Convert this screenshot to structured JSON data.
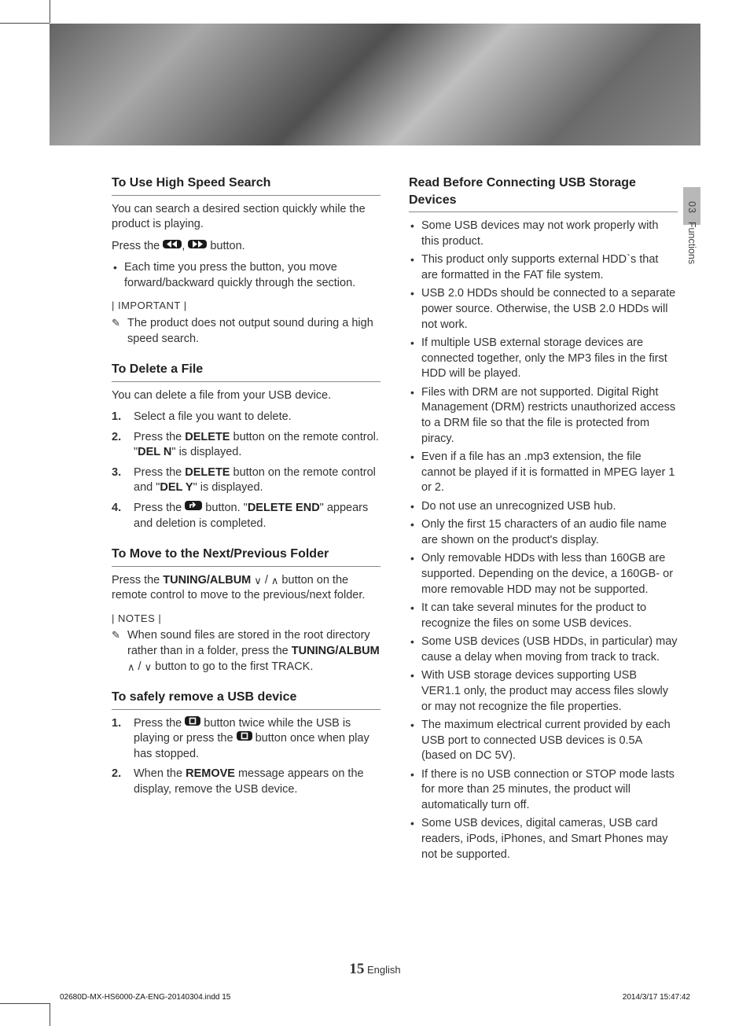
{
  "side": {
    "chapter": "03",
    "label": "Functions"
  },
  "left": {
    "s1": {
      "title": "To Use High Speed Search",
      "intro": "You can search a desired section quickly while the product is playing.",
      "press_pre": "Press the ",
      "press_sep": ", ",
      "press_post": " button.",
      "b1": "Each time you press the button, you move forward/backward quickly through the section.",
      "important": "| IMPORTANT |",
      "note1": "The product does not output sound during a high speed search."
    },
    "s2": {
      "title": "To Delete a File",
      "intro": "You can delete a file from your USB device.",
      "li1": "Select a file you want to delete.",
      "li2a": "Press the ",
      "li2b": "DELETE",
      "li2c": " button on the remote control. \"",
      "li2d": "DEL N",
      "li2e": "\" is displayed.",
      "li3a": "Press the ",
      "li3b": "DELETE",
      "li3c": " button on the remote control and \"",
      "li3d": "DEL Y",
      "li3e": "\" is displayed.",
      "li4a": "Press the ",
      "li4b": " button. \"",
      "li4c": "DELETE END",
      "li4d": "\" appears and deletion is completed."
    },
    "s3": {
      "title": "To Move to the Next/Previous Folder",
      "p_a": "Press the ",
      "p_b": "TUNING/ALBUM",
      "p_c": " button on the remote control to move to the previous/next folder.",
      "notes": "| NOTES |",
      "n_a": "When sound files are stored in the root directory rather than in a folder, press the ",
      "n_b": "TUNING/ALBUM",
      "n_c": " button to go to the first TRACK."
    },
    "s4": {
      "title": "To safely remove a USB device",
      "li1a": "Press the ",
      "li1b": " button twice while the USB is playing or press the ",
      "li1c": " button once when play has stopped.",
      "li2a": "When the ",
      "li2b": "REMOVE",
      "li2c": " message appears on the display, remove the USB device."
    }
  },
  "right": {
    "title": "Read Before Connecting USB Storage Devices",
    "items": [
      "Some USB devices may not work properly with this product.",
      "This product only supports external HDD`s that are formatted in the FAT file system.",
      "USB 2.0 HDDs should be connected to a separate power source. Otherwise, the USB 2.0 HDDs will not work.",
      "If multiple USB external storage devices are connected together, only the MP3 files in the first HDD will be played.",
      "Files with DRM are not supported. Digital Right Management (DRM) restricts unauthorized access to a DRM file so that the file is protected from piracy.",
      "Even if a file has an .mp3 extension, the file cannot be played if it is formatted in MPEG layer 1 or 2.",
      "Do not use an unrecognized USB hub.",
      "Only the first 15 characters of an audio file name are shown on the product's display.",
      "Only removable HDDs with less than 160GB are supported. Depending on the device, a 160GB- or more removable HDD may not be supported.",
      "It can take several minutes for the product to recognize the files on some USB devices.",
      "Some USB devices (USB HDDs, in particular) may cause a delay when moving from track to track.",
      "With USB storage devices supporting USB VER1.1 only, the product may access files slowly or may not recognize the file properties.",
      "The maximum electrical current provided by each USB port to connected USB devices is 0.5A (based on DC 5V).",
      "If there is no USB connection or STOP mode lasts for more than 25 minutes, the product will automatically turn off.",
      "Some USB devices, digital cameras, USB card readers, iPods, iPhones, and Smart Phones may not be supported."
    ]
  },
  "footer": {
    "page": "15",
    "lang": "English"
  },
  "print": {
    "left": "02680D-MX-HS6000-ZA-ENG-20140304.indd   15",
    "right": "2014/3/17   15:47:42"
  }
}
